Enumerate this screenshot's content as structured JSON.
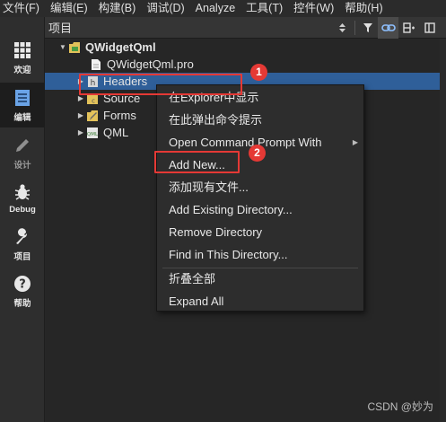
{
  "menubar": {
    "items": [
      "文件(F)",
      "编辑(E)",
      "构建(B)",
      "调试(D)",
      "Analyze",
      "工具(T)",
      "控件(W)",
      "帮助(H)"
    ]
  },
  "modes": [
    {
      "label": "欢迎",
      "icon": "grid-icon"
    },
    {
      "label": "编辑",
      "icon": "document-edit-icon"
    },
    {
      "label": "设计",
      "icon": "pencil-icon"
    },
    {
      "label": "Debug",
      "icon": "bug-icon"
    },
    {
      "label": "项目",
      "icon": "wrench-icon"
    },
    {
      "label": "帮助",
      "icon": "help-icon"
    }
  ],
  "pane": {
    "title": "项目",
    "tools": [
      "updown-icon",
      "filter-icon",
      "link-icon",
      "split-icon",
      "close-icon"
    ]
  },
  "tree": {
    "root": "QWidgetQml",
    "items": [
      {
        "label": "QWidgetQml.pro",
        "icon": "pro-file-icon"
      },
      {
        "label": "Headers",
        "icon": "header-folder-icon"
      },
      {
        "label": "Sources",
        "icon": "source-folder-icon"
      },
      {
        "label": "Forms",
        "icon": "forms-folder-icon"
      },
      {
        "label": "QML",
        "icon": "qml-folder-icon"
      }
    ],
    "visible_labels": {
      "sources": "Source",
      "forms": "Forms"
    }
  },
  "context_menu": {
    "items": [
      "在Explorer中显示",
      "在此弹出命令提示",
      "Open Command Prompt With",
      "Add New...",
      "添加现有文件...",
      "Add Existing Directory...",
      "Remove Directory",
      "Find in This Directory...",
      "折叠全部",
      "Expand All"
    ]
  },
  "annotations": [
    "1",
    "2"
  ],
  "colors": {
    "selection": "#2f5f99",
    "annotation": "#e53935",
    "background": "#262626"
  },
  "watermark": "CSDN @妙为"
}
